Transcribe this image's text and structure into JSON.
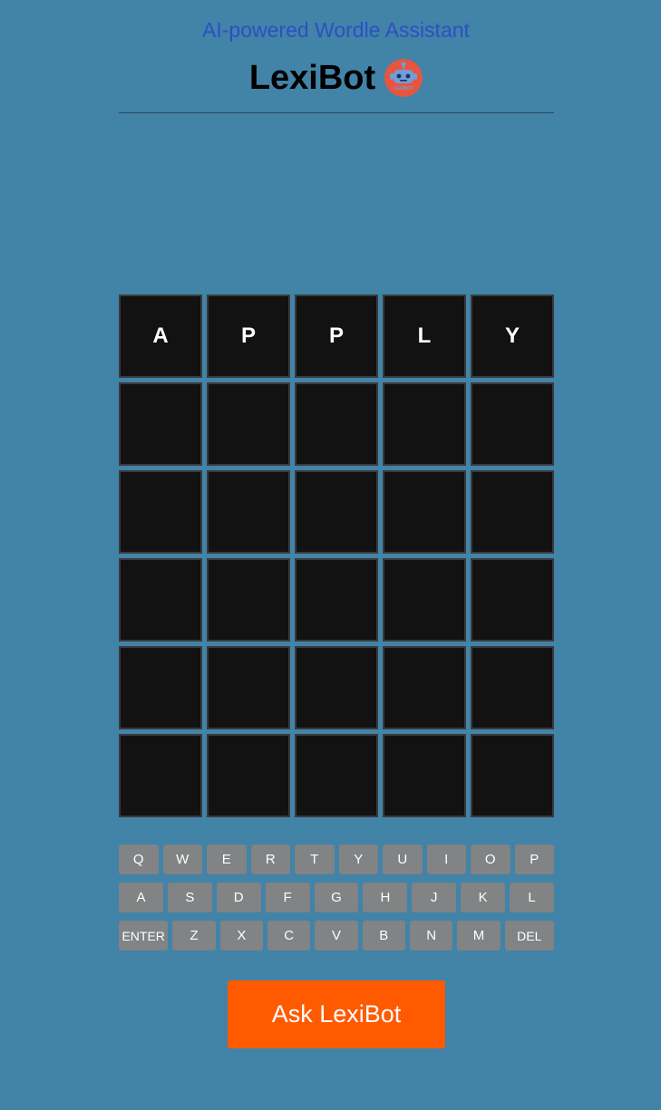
{
  "header": {
    "subtitle": "AI-powered Wordle Assistant",
    "title": "LexiBot",
    "logo_text": "LEXIBOT"
  },
  "grid": {
    "rows": [
      [
        "A",
        "P",
        "P",
        "L",
        "Y"
      ],
      [
        "",
        "",
        "",
        "",
        ""
      ],
      [
        "",
        "",
        "",
        "",
        ""
      ],
      [
        "",
        "",
        "",
        "",
        ""
      ],
      [
        "",
        "",
        "",
        "",
        ""
      ],
      [
        "",
        "",
        "",
        "",
        ""
      ]
    ]
  },
  "keyboard": {
    "rows": [
      [
        "Q",
        "W",
        "E",
        "R",
        "T",
        "Y",
        "U",
        "I",
        "O",
        "P"
      ],
      [
        "A",
        "S",
        "D",
        "F",
        "G",
        "H",
        "J",
        "K",
        "L"
      ],
      [
        "ENTER",
        "Z",
        "X",
        "C",
        "V",
        "B",
        "N",
        "M",
        "DEL"
      ]
    ]
  },
  "action": {
    "ask_label": "Ask LexiBot"
  },
  "colors": {
    "background": "#4283a8",
    "tile": "#121212",
    "key": "#818384",
    "button": "#ff5a00",
    "subtitle": "#2d4fc4"
  }
}
